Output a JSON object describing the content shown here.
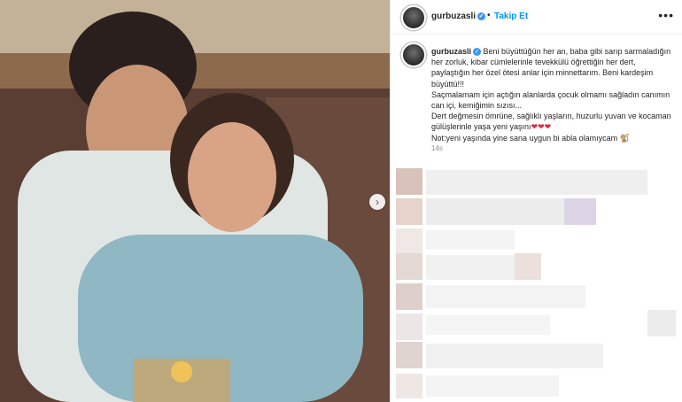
{
  "post": {
    "username": "gurbuzasli",
    "dot": "•",
    "follow_label": "Takip Et",
    "more_icon": "more-options-icon"
  },
  "caption": {
    "username": "gurbuzasli",
    "line1": "Beni büyüttüğün her an, baba gibi sarıp sarmaladığın her zorluk, kibar cümlelerinle tevekkülü öğrettiğin her dert, paylaştığın her özel ötesi anlar için minnettarım. Beni kardeşim büyüttü!!!",
    "line2": "Saçmalamam için açtığın alanlarda çocuk olmamı sağladın canımın can içi, kemiğimin sızısı...",
    "line3": "Dert değmesin ömrüne, sağlıklı yaşların, huzurlu yuvan ve kocaman gülüşlerinle yaşa yeni yaşını",
    "hearts": "❤❤❤",
    "line4": "Not:yeni yaşında yine sana uygun bi abla olamıycam",
    "emoji": "🐒",
    "time": "14s"
  },
  "colors": {
    "accent": "#0095f6",
    "verified": "#3897f0",
    "heart": "#e0263b"
  }
}
